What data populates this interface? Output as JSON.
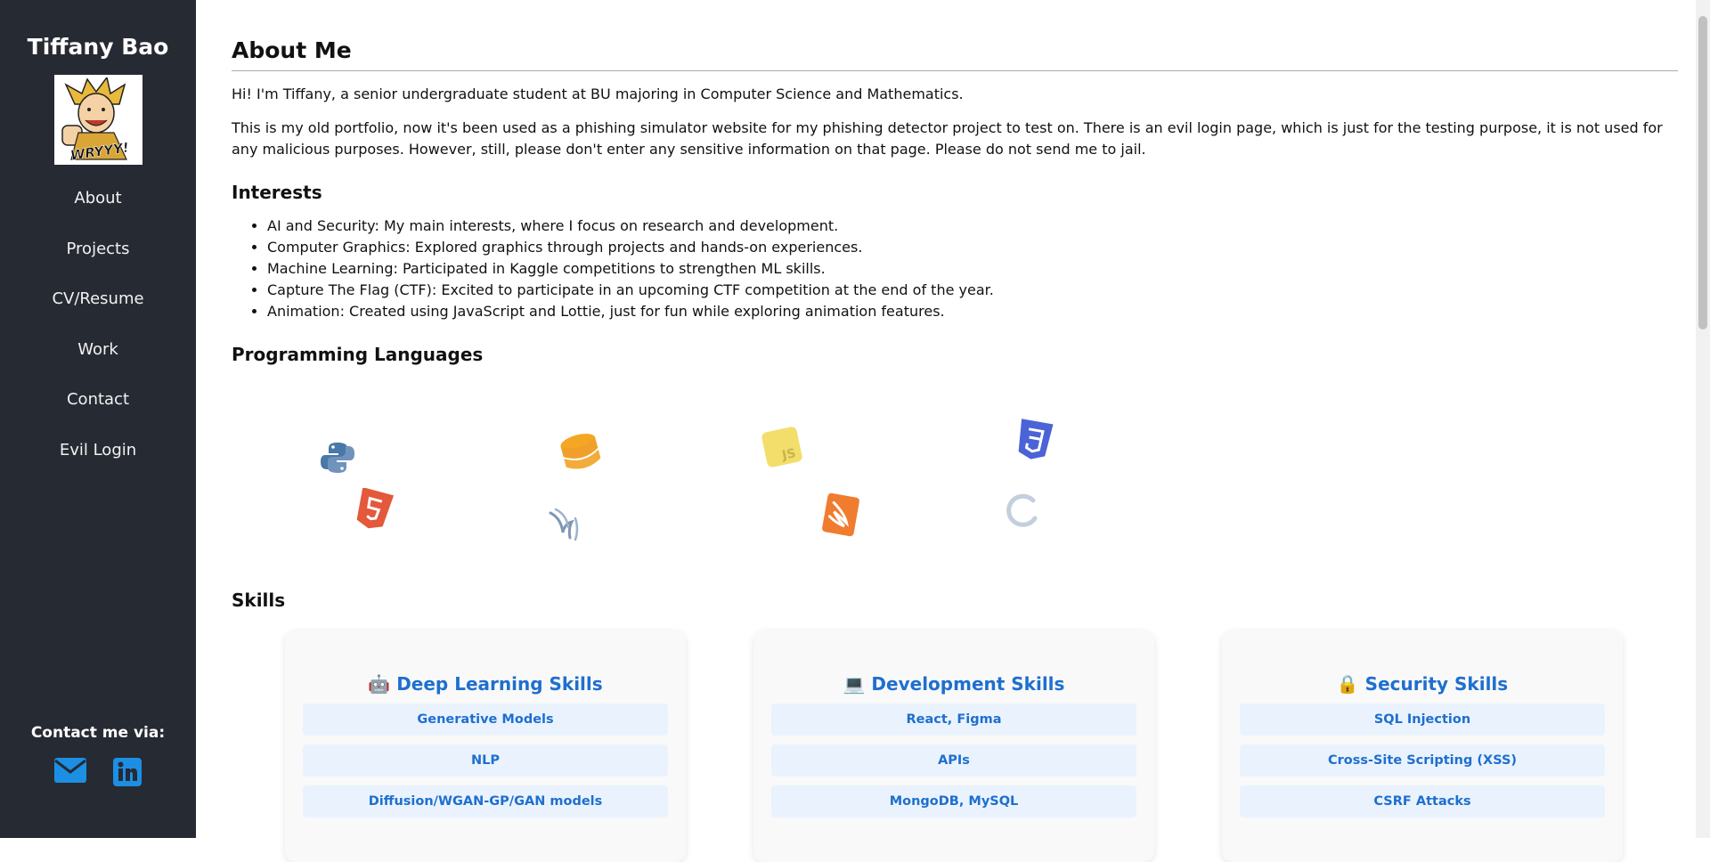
{
  "sidebar": {
    "name": "Tiffany Bao",
    "avatar_text": "WRYYY!",
    "nav": [
      "About",
      "Projects",
      "CV/Resume",
      "Work",
      "Contact",
      "Evil Login"
    ],
    "contact_label": "Contact me via:",
    "contact_icons": [
      "email-icon",
      "linkedin-icon"
    ]
  },
  "main": {
    "title": "About Me",
    "intro": "Hi! I'm Tiffany, a senior undergraduate student at BU majoring in Computer Science and Mathematics.",
    "portfolio_note": "This is my old portfolio, now it's been used as a phishing simulator website for my phishing detector project to test on. There is an evil login page, which is just for the testing purpose, it is not used for any malicious purposes. However, still, please don't enter any sensitive information on that page. Please do not send me to jail.",
    "interests_title": "Interests",
    "interests": [
      "AI and Security: My main interests, where I focus on research and development.",
      "Computer Graphics: Explored graphics through projects and hands-on experiences.",
      "Machine Learning: Participated in Kaggle competitions to strengthen ML skills.",
      "Capture The Flag (CTF): Excited to participate in an upcoming CTF competition at the end of the year.",
      "Animation: Created using JavaScript and Lottie, just for fun while exploring animation features."
    ],
    "languages_title": "Programming Languages",
    "language_icons": [
      "python-icon",
      "database-icon",
      "javascript-icon",
      "css3-icon",
      "html5-icon",
      "seaborn-icon",
      "swift-icon",
      "c-language-icon"
    ],
    "skills_title": "Skills",
    "skill_cards": [
      {
        "emoji": "🤖",
        "title": "Deep Learning Skills",
        "items": [
          "Generative Models",
          "NLP",
          "Diffusion/WGAN-GP/GAN models"
        ]
      },
      {
        "emoji": "💻",
        "title": "Development Skills",
        "items": [
          "React, Figma",
          "APIs",
          "MongoDB, MySQL"
        ]
      },
      {
        "emoji": "🔒",
        "title": "Security Skills",
        "items": [
          "SQL Injection",
          "Cross-Site Scripting (XSS)",
          "CSRF Attacks"
        ]
      }
    ]
  },
  "colors": {
    "sidebar_bg": "#262a33",
    "accent": "#1e6fcf",
    "skill_bg": "#eaf3fd",
    "contact_icon": "#1c8fe3"
  }
}
